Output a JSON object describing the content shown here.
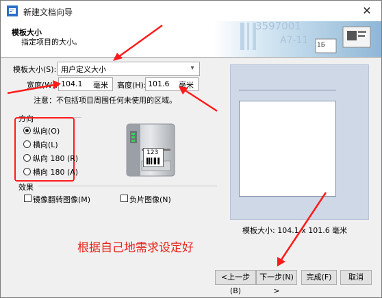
{
  "window": {
    "title": "新建文档向导",
    "close_glyph": "✕"
  },
  "header": {
    "title": "模板大小",
    "subtitle": "指定项目的大小。"
  },
  "form": {
    "template_size_label": "模板大小(S):",
    "template_size_value": "用户定义大小",
    "width_label": "宽度(W):",
    "width_value": "104.1",
    "width_unit": "毫米",
    "height_label": "高度(H):",
    "height_value": "101.6",
    "height_unit": "毫米",
    "note": "注意：不包括项目周围任何未使用的区域。"
  },
  "orientation": {
    "legend": "方向",
    "options": [
      {
        "label": "纵向(O)",
        "checked": true
      },
      {
        "label": "横向(L)",
        "checked": false
      },
      {
        "label": "纵向 180 (R)",
        "checked": false
      },
      {
        "label": "横向 180 (A)",
        "checked": false
      }
    ]
  },
  "effects": {
    "legend": "效果",
    "mirror_label": "镜像翻转图像(M)",
    "negative_label": "负片图像(N)"
  },
  "printer_label_text": "123",
  "preview": {
    "size_text": "模板大小:  104.1 x 101.6 毫米"
  },
  "annotation": {
    "text": "根据自己地需求设定好"
  },
  "buttons": {
    "back": "<上一步(B)",
    "next": "下一步(N) >",
    "finish": "完成(F)",
    "cancel": "取消"
  },
  "header_art": {
    "text1": "3597001",
    "text2": "A7-11",
    "text3": "1Б"
  },
  "colors": {
    "accent": "#ff1a1a",
    "window_bg": "#f0f0f0"
  },
  "icons": [
    "app-icon",
    "close-icon",
    "chevron-down-icon",
    "printer-icon",
    "barcode-icon"
  ]
}
